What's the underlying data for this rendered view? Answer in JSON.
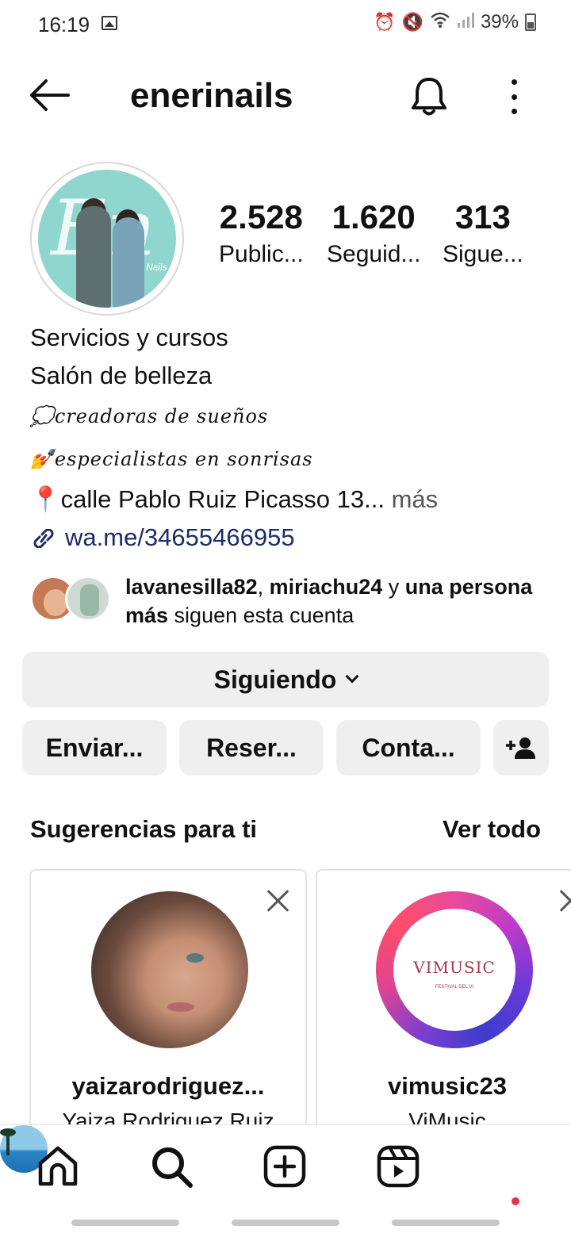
{
  "status_bar": {
    "time": "16:19",
    "battery": "39%"
  },
  "header": {
    "username": "enerinails"
  },
  "profile": {
    "stats": [
      {
        "value": "2.528",
        "label": "Public..."
      },
      {
        "value": "1.620",
        "label": "Seguid..."
      },
      {
        "value": "313",
        "label": "Sigue..."
      }
    ],
    "bio": {
      "name": "Servicios y cursos",
      "category": "Salón de belleza",
      "line1_emoji": "💭",
      "line1_text": "creadoras de sueños",
      "line2_emoji": "💅",
      "line2_text": "especialistas en sonrisas",
      "address_emoji": "📍",
      "address": "calle Pablo Ruiz Picasso 13...",
      "more": "más",
      "link": "wa.me/34655466955"
    },
    "followed_by": {
      "user1": "lavanesilla82",
      "sep": ", ",
      "user2": "miriachu24",
      "and": " y ",
      "others": "una persona más",
      "suffix": " siguen esta cuenta"
    }
  },
  "actions": {
    "following": "Siguiendo",
    "message": "Enviar...",
    "book": "Reser...",
    "contact": "Conta..."
  },
  "suggestions": {
    "title": "Sugerencias para ti",
    "see_all": "Ver todo",
    "cards": [
      {
        "handle": "yaizarodriguez...",
        "name": "Yaiza Rodriguez Ruiz"
      },
      {
        "handle": "vimusic23",
        "name": "ViMusic",
        "logo_text": "VIMUSIC",
        "logo_sub": "FESTIVAL DEL VI"
      }
    ]
  },
  "colors": {
    "button_bg": "#efefef",
    "link": "#1d2a6b",
    "notification_dot": "#e8334a"
  }
}
